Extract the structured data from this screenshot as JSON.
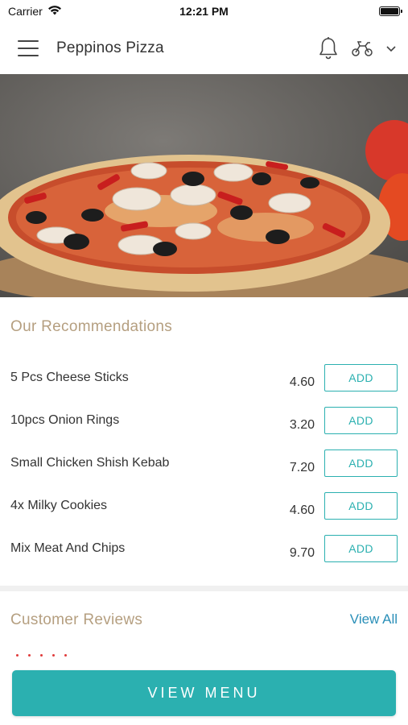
{
  "status_bar": {
    "carrier": "Carrier",
    "time": "12:21 PM"
  },
  "header": {
    "title": "Peppinos Pizza",
    "icons": [
      "menu-icon",
      "bell-icon",
      "scooter-icon",
      "chevron-down-icon"
    ]
  },
  "recommendations": {
    "title": "Our Recommendations",
    "add_label": "ADD",
    "items": [
      {
        "name": "5 Pcs Cheese Sticks",
        "price": "4.60"
      },
      {
        "name": "10pcs Onion Rings",
        "price": "3.20"
      },
      {
        "name": "Small Chicken Shish Kebab",
        "price": "7.20"
      },
      {
        "name": "4x Milky Cookies",
        "price": "4.60"
      },
      {
        "name": "Mix Meat And Chips",
        "price": "9.70"
      }
    ]
  },
  "reviews": {
    "title": "Customer Reviews",
    "view_all": "View All"
  },
  "footer": {
    "view_menu": "VIEW MENU"
  },
  "colors": {
    "accent": "#2bb0b0",
    "section_title": "#b59f80",
    "link": "#2a8fb8"
  }
}
